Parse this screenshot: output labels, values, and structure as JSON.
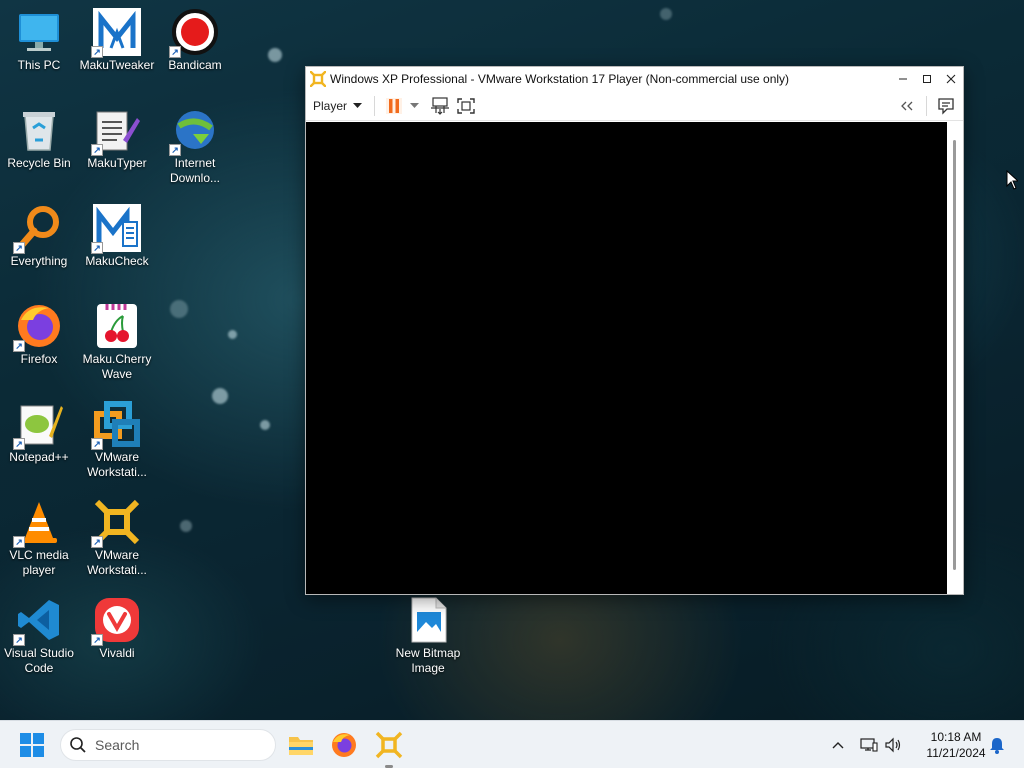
{
  "desktop": {
    "icons": [
      {
        "label": "This PC",
        "icon": "this-pc-icon"
      },
      {
        "label": "MakuTweaker",
        "icon": "makutweaker-icon"
      },
      {
        "label": "Bandicam",
        "icon": "bandicam-icon"
      },
      {
        "label": "Recycle Bin",
        "icon": "recycle-bin-icon"
      },
      {
        "label": "MakuTyper",
        "icon": "makutyper-icon"
      },
      {
        "label": "Internet Downlo...",
        "icon": "internet-download-manager-icon"
      },
      {
        "label": "Everything",
        "icon": "everything-search-icon"
      },
      {
        "label": "MakuCheck",
        "icon": "makucheck-icon"
      },
      {
        "label": "Firefox",
        "icon": "firefox-icon"
      },
      {
        "label": "Maku.Cherry Wave",
        "icon": "cherry-icon"
      },
      {
        "label": "Notepad++",
        "icon": "notepad-plus-plus-icon"
      },
      {
        "label": "VMware Workstati...",
        "icon": "vmware-workstation-icon"
      },
      {
        "label": "VLC media player",
        "icon": "vlc-icon"
      },
      {
        "label": "VMware Workstati...",
        "icon": "vmware-player-icon"
      },
      {
        "label": "Visual Studio Code",
        "icon": "vscode-icon"
      },
      {
        "label": "Vivaldi",
        "icon": "vivaldi-icon"
      },
      {
        "label": "New Bitmap Image",
        "icon": "bitmap-image-icon"
      }
    ]
  },
  "vm_window": {
    "title": "Windows XP Professional - VMware Workstation 17 Player (Non-commercial use only)",
    "player_menu_label": "Player"
  },
  "taskbar": {
    "search_placeholder": "Search",
    "time": "10:18 AM",
    "date": "11/21/2024"
  }
}
